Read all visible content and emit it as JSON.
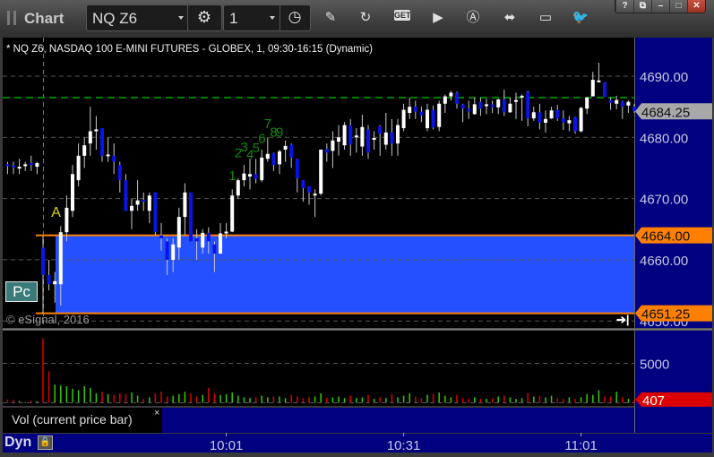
{
  "toolbar": {
    "app_title": "Chart",
    "symbol": "NQ Z6",
    "interval": "1",
    "icons": [
      "grip-icon",
      "gear-icon",
      "clock-icon",
      "pencil-icon",
      "chart-refresh-icon",
      "get-icon",
      "play-icon",
      "alert-a-icon",
      "link-icon",
      "comment-icon",
      "twitter-icon"
    ],
    "get_label": "GET",
    "window_buttons": {
      "help": "?",
      "restore": "⧉",
      "minimize": "–",
      "maximize": "□",
      "close": "✕"
    }
  },
  "chart_header": "* NQ Z6, NASDAQ 100 E-MINI FUTURES - GLOBEX, 1, 09:30-16:15 (Dynamic)",
  "pc_label": "Pc",
  "copyright": "© eSignal, 2016",
  "volume_legend": "Vol (current price bar)",
  "volume_legend_close": "×",
  "dyn_label": "Dyn",
  "colors": {
    "background": "#000000",
    "axis_panel": "#000080",
    "up_body": "#ffffff",
    "down_body": "#0a14e6",
    "range_fill": "#2450ff",
    "range_line": "#ff8000",
    "level_line": "#008000",
    "vol_up": "#33cc00",
    "vol_down": "#dd0000",
    "last_price_tag": "#a8a8a8",
    "annotation_a": "#d8d800",
    "td_count": "#118811"
  },
  "chart_data": {
    "type": "candlestick",
    "title": "",
    "y_ticks": [
      "4690.00",
      "4680.00",
      "4670.00",
      "4660.00",
      "4650.00"
    ],
    "y_tick_values": [
      4690,
      4680,
      4670,
      4660,
      4650
    ],
    "ylim": [
      4648.5,
      4696
    ],
    "x_ticks": [
      "10:01",
      "10:31",
      "11:01"
    ],
    "session_start": "09:30",
    "grid": true,
    "price_tags": [
      {
        "label": "4684.25",
        "value": 4684.25,
        "kind": "last"
      },
      {
        "label": "4664.00",
        "value": 4664.0,
        "kind": "range-high"
      },
      {
        "label": "4651.25",
        "value": 4651.25,
        "kind": "range-low"
      }
    ],
    "range_zone": {
      "high": 4664.0,
      "low": 4651.25
    },
    "level_line": 4686.5,
    "volume": {
      "y_ticks": [
        "5000"
      ],
      "y_tick_values": [
        5000
      ],
      "tag": {
        "label": "407",
        "value": 407
      }
    },
    "annotations": [
      {
        "text": "A",
        "time": "09:32",
        "price": 4667.9,
        "kind": "a"
      },
      {
        "text": "1",
        "time": "10:02",
        "price": 4673.9,
        "kind": "td"
      },
      {
        "text": "2",
        "time": "10:03",
        "price": 4677.6,
        "kind": "td"
      },
      {
        "text": "3",
        "time": "10:04",
        "price": 4678.6,
        "kind": "td"
      },
      {
        "text": "4",
        "time": "10:05",
        "price": 4677.3,
        "kind": "td"
      },
      {
        "text": "5",
        "time": "10:06",
        "price": 4678.4,
        "kind": "td"
      },
      {
        "text": "6",
        "time": "10:07",
        "price": 4680.0,
        "kind": "td"
      },
      {
        "text": "7",
        "time": "10:08",
        "price": 4682.4,
        "kind": "td"
      },
      {
        "text": "8",
        "time": "10:09",
        "price": 4681.0,
        "kind": "td"
      },
      {
        "text": "9",
        "time": "10:10",
        "price": 4681.0,
        "kind": "td"
      }
    ],
    "columns": [
      "time",
      "open",
      "high",
      "low",
      "close",
      "volume"
    ],
    "bars": [
      [
        "09:24",
        4675.6,
        4676,
        4674,
        4675.3,
        400
      ],
      [
        "09:25",
        4675.4,
        4676,
        4674,
        4675.1,
        400
      ],
      [
        "09:26",
        4675,
        4676.5,
        4674,
        4675.2,
        250
      ],
      [
        "09:27",
        4675.3,
        4676,
        4674.5,
        4675.6,
        100
      ],
      [
        "09:28",
        4675.8,
        4677,
        4674.5,
        4675.5,
        300
      ],
      [
        "09:29",
        4675.2,
        4676,
        4674,
        4675.8,
        200
      ],
      [
        "09:30",
        4662,
        4664,
        4651.25,
        4657.5,
        8200
      ],
      [
        "09:31",
        4657.5,
        4660,
        4655,
        4656,
        4000
      ],
      [
        "09:32",
        4656,
        4658,
        4653,
        4656.5,
        2300
      ],
      [
        "09:33",
        4656,
        4665.5,
        4652.5,
        4664.5,
        2200
      ],
      [
        "09:34",
        4664.5,
        4670.5,
        4663,
        4668.5,
        2100
      ],
      [
        "09:35",
        4668,
        4675.5,
        4667,
        4674,
        1800
      ],
      [
        "09:36",
        4673,
        4679,
        4672,
        4677,
        1600
      ],
      [
        "09:37",
        4677,
        4680,
        4675,
        4678.7,
        2100
      ],
      [
        "09:38",
        4679,
        4685,
        4677,
        4681,
        1900
      ],
      [
        "09:39",
        4681,
        4683.5,
        4678,
        4681.3,
        1200
      ],
      [
        "09:40",
        4681.5,
        4681.5,
        4676,
        4677,
        1400
      ],
      [
        "09:41",
        4677,
        4680,
        4676,
        4677.2,
        1100
      ],
      [
        "09:42",
        4677,
        4679,
        4674,
        4676,
        1000
      ],
      [
        "09:43",
        4675.5,
        4676,
        4671,
        4673,
        1200
      ],
      [
        "09:44",
        4673,
        4674,
        4668,
        4668,
        1100
      ],
      [
        "09:45",
        4668,
        4670,
        4665,
        4668.8,
        1300
      ],
      [
        "09:46",
        4669,
        4673,
        4668,
        4669.7,
        900
      ],
      [
        "09:47",
        4669.8,
        4671,
        4668,
        4669.6,
        500
      ],
      [
        "09:48",
        4668,
        4671,
        4666,
        4670.5,
        700
      ],
      [
        "09:49",
        4671,
        4671,
        4664,
        4664.5,
        1200
      ],
      [
        "09:50",
        4664,
        4666,
        4661.5,
        4663.5,
        1400
      ],
      [
        "09:51",
        4663,
        4663.5,
        4657.5,
        4660,
        800
      ],
      [
        "09:52",
        4660,
        4663.5,
        4658,
        4662.5,
        900
      ],
      [
        "09:53",
        4662,
        4668.5,
        4660,
        4667,
        1100
      ],
      [
        "09:54",
        4667,
        4672.5,
        4664,
        4671,
        1400
      ],
      [
        "09:55",
        4671,
        4671,
        4663,
        4663,
        1200
      ],
      [
        "09:56",
        4663.5,
        4665,
        4660,
        4663,
        800
      ],
      [
        "09:57",
        4662,
        4665,
        4661,
        4664.4,
        1000
      ],
      [
        "09:58",
        4664.4,
        4665.3,
        4661,
        4663,
        1900
      ],
      [
        "09:59",
        4662.5,
        4663,
        4658,
        4661,
        1200
      ],
      [
        "10:00",
        4661,
        4666,
        4661,
        4664.3,
        1000
      ],
      [
        "10:01",
        4664.3,
        4666,
        4663.5,
        4664.6,
        1100
      ],
      [
        "10:02",
        4664.6,
        4671.5,
        4664.5,
        4670.5,
        1300
      ],
      [
        "10:03",
        4670.5,
        4673.3,
        4670,
        4673,
        900
      ],
      [
        "10:04",
        4673,
        4675.5,
        4672,
        4674.1,
        700
      ],
      [
        "10:05",
        4673.6,
        4676.5,
        4671.5,
        4674,
        600
      ],
      [
        "10:06",
        4674,
        4676.5,
        4672.5,
        4673.2,
        700
      ],
      [
        "10:07",
        4673,
        4678,
        4672.7,
        4676.7,
        900
      ],
      [
        "10:08",
        4676.5,
        4680,
        4676,
        4677.3,
        700
      ],
      [
        "10:09",
        4677.4,
        4677.5,
        4674.5,
        4675.5,
        800
      ],
      [
        "10:10",
        4675.6,
        4678,
        4674,
        4677.7,
        800
      ],
      [
        "10:11",
        4678,
        4679.5,
        4676,
        4678.6,
        600
      ],
      [
        "10:12",
        4678.8,
        4679,
        4675,
        4676.7,
        1000
      ],
      [
        "10:13",
        4676.5,
        4676.5,
        4671,
        4673.3,
        800
      ],
      [
        "10:14",
        4673,
        4673,
        4669.5,
        4671.7,
        600
      ],
      [
        "10:15",
        4672,
        4672,
        4669,
        4671,
        700
      ],
      [
        "10:16",
        4670.5,
        4671.5,
        4667,
        4670.8,
        800
      ],
      [
        "10:17",
        4670.8,
        4678,
        4670.5,
        4678,
        1200
      ],
      [
        "10:18",
        4678.1,
        4679,
        4676,
        4677.5,
        600
      ],
      [
        "10:19",
        4677.8,
        4681,
        4675,
        4679.5,
        700
      ],
      [
        "10:20",
        4679.3,
        4682,
        4677,
        4680,
        800
      ],
      [
        "10:21",
        4678.7,
        4682.5,
        4678,
        4682,
        600
      ],
      [
        "10:22",
        4682,
        4683,
        4677,
        4678.8,
        900
      ],
      [
        "10:23",
        4680,
        4681.5,
        4677.5,
        4680.3,
        600
      ],
      [
        "10:24",
        4678.5,
        4683.7,
        4677,
        4681.7,
        700
      ],
      [
        "10:25",
        4681.3,
        4682,
        4676.5,
        4677.5,
        1000
      ],
      [
        "10:26",
        4679.8,
        4681,
        4678,
        4679.9,
        500
      ],
      [
        "10:27",
        4681.8,
        4682,
        4677,
        4680.6,
        700
      ],
      [
        "10:28",
        4678.8,
        4684,
        4678,
        4680.8,
        600
      ],
      [
        "10:29",
        4680.8,
        4683,
        4677,
        4679,
        1100
      ],
      [
        "10:30",
        4679,
        4683,
        4677,
        4682,
        700
      ],
      [
        "10:31",
        4681.5,
        4685.5,
        4681,
        4684.5,
        900
      ],
      [
        "10:32",
        4684,
        4686.5,
        4683,
        4685,
        1200
      ],
      [
        "10:33",
        4685,
        4686,
        4683,
        4684.2,
        800
      ],
      [
        "10:34",
        4684.2,
        4685,
        4682.5,
        4683.6,
        600
      ],
      [
        "10:35",
        4681.5,
        4685.5,
        4681,
        4684.5,
        1000
      ],
      [
        "10:36",
        4684.5,
        4685.2,
        4681.3,
        4681.6,
        1100
      ],
      [
        "10:37",
        4681.7,
        4686,
        4681,
        4685.5,
        1300
      ],
      [
        "10:38",
        4685.5,
        4687,
        4684,
        4686.7,
        900
      ],
      [
        "10:39",
        4686.7,
        4687.6,
        4686,
        4687.3,
        700
      ],
      [
        "10:40",
        4687.3,
        4687.5,
        4684.7,
        4685.5,
        1000
      ],
      [
        "10:41",
        4685.4,
        4685.5,
        4682.5,
        4684.7,
        600
      ],
      [
        "10:42",
        4684.7,
        4686,
        4683,
        4684.2,
        500
      ],
      [
        "10:43",
        4683.8,
        4686.5,
        4683.7,
        4685.4,
        700
      ],
      [
        "10:44",
        4685.8,
        4686.5,
        4683.5,
        4684.7,
        500
      ],
      [
        "10:45",
        4685.2,
        4686.3,
        4683.8,
        4685.4,
        500
      ],
      [
        "10:46",
        4685.4,
        4686,
        4684,
        4684.9,
        600
      ],
      [
        "10:47",
        4684.9,
        4686.3,
        4683.8,
        4686.2,
        800
      ],
      [
        "10:48",
        4686.2,
        4687.8,
        4683.5,
        4684.1,
        900
      ],
      [
        "10:49",
        4684.1,
        4686.5,
        4684,
        4685.5,
        700
      ],
      [
        "10:50",
        4685.9,
        4687.3,
        4683,
        4686.1,
        500
      ],
      [
        "10:51",
        4686.6,
        4687,
        4682.7,
        4686.8,
        600
      ],
      [
        "10:52",
        4687.4,
        4687.6,
        4681.8,
        4683.1,
        1200
      ],
      [
        "10:53",
        4683.1,
        4685,
        4682.7,
        4684.1,
        800
      ],
      [
        "10:54",
        4684.1,
        4685.5,
        4681.3,
        4682.4,
        900
      ],
      [
        "10:55",
        4682.4,
        4684.4,
        4680.8,
        4683,
        700
      ],
      [
        "10:56",
        4683.1,
        4685,
        4683,
        4684.4,
        900
      ],
      [
        "10:57",
        4684.5,
        4685.3,
        4682.7,
        4683.1,
        600
      ],
      [
        "10:58",
        4683.1,
        4684.4,
        4681.2,
        4682.4,
        500
      ],
      [
        "10:59",
        4682.3,
        4683.5,
        4681,
        4682.8,
        700
      ],
      [
        "11:00",
        4683.3,
        4683.4,
        4680.6,
        4681,
        500
      ],
      [
        "11:01",
        4681,
        4685,
        4680.8,
        4684.8,
        700
      ],
      [
        "11:02",
        4684.7,
        4686.6,
        4683.8,
        4686.5,
        1100
      ],
      [
        "11:03",
        4686.7,
        4690.7,
        4686.7,
        4689.4,
        1000
      ],
      [
        "11:04",
        4689.1,
        4692.2,
        4689,
        4689.3,
        1600
      ],
      [
        "11:05",
        4689,
        4689,
        4686.6,
        4686.6,
        800
      ],
      [
        "11:06",
        4686.1,
        4686.5,
        4684.5,
        4685.6,
        800
      ],
      [
        "11:07",
        4685.5,
        4686.8,
        4684.6,
        4686.1,
        1400
      ],
      [
        "11:08",
        4685.9,
        4686,
        4683,
        4685,
        700
      ],
      [
        "11:09",
        4685.2,
        4686,
        4684,
        4685.8,
        500
      ],
      [
        "11:10",
        4685,
        4685.5,
        4684,
        4684.25,
        407
      ]
    ]
  }
}
